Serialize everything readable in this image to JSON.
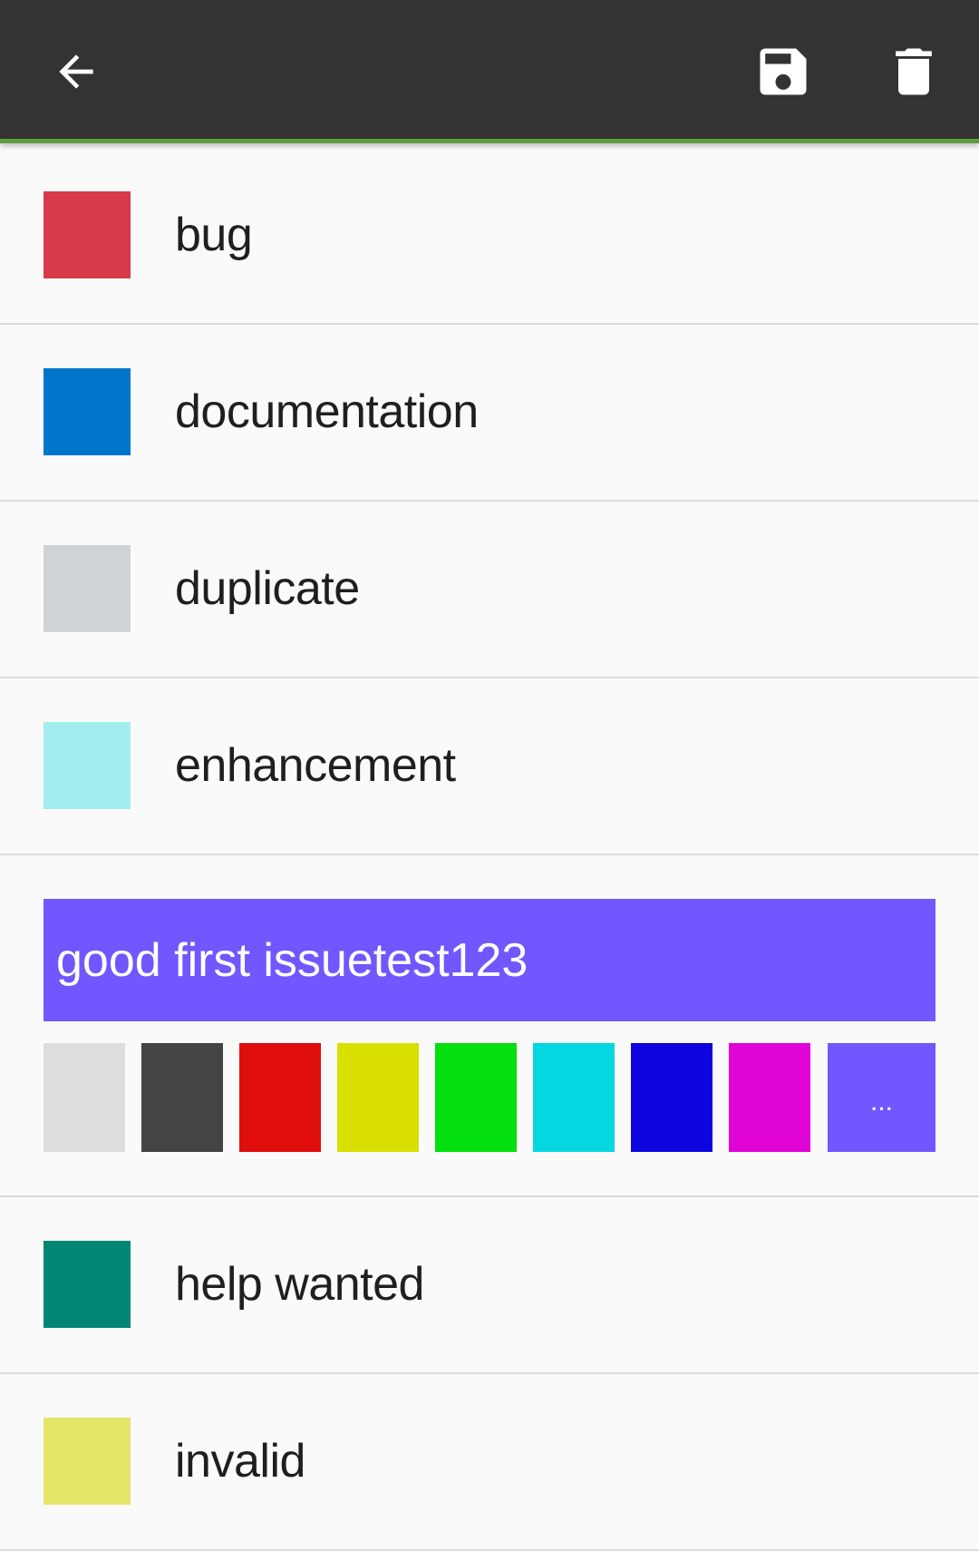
{
  "toolbar": {
    "background": "#333333",
    "accent": "#5d9c3f",
    "back_icon": "arrow-left-icon",
    "save_icon": "save-floppy-icon",
    "delete_icon": "trash-icon"
  },
  "labels_before": [
    {
      "name": "bug",
      "color": "#d73a4a"
    },
    {
      "name": "documentation",
      "color": "#0075ca"
    },
    {
      "name": "duplicate",
      "color": "#cfd3d7"
    },
    {
      "name": "enhancement",
      "color": "#a2eeef"
    }
  ],
  "editing": {
    "value": "good first issuetest123",
    "color": "#7057ff",
    "palette": [
      "#dddddd",
      "#444444",
      "#e00d0d",
      "#d9e000",
      "#04e00d",
      "#04d7e0",
      "#0d04e0",
      "#e004d7"
    ],
    "more_label": "..."
  },
  "labels_after": [
    {
      "name": "help wanted",
      "color": "#008672"
    },
    {
      "name": "invalid",
      "color": "#e4e669"
    }
  ]
}
